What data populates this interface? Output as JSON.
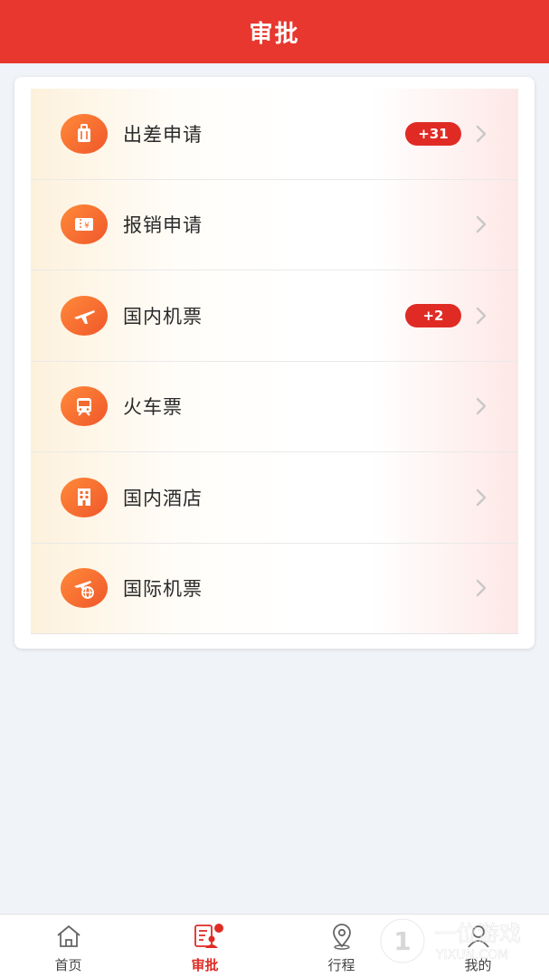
{
  "header": {
    "title": "审批"
  },
  "menu": {
    "items": [
      {
        "label": "出差申请",
        "icon": "luggage-icon",
        "badge": "+31"
      },
      {
        "label": "报销申请",
        "icon": "reimbursement-ticket-icon",
        "badge": ""
      },
      {
        "label": "国内机票",
        "icon": "airplane-icon",
        "badge": "+2"
      },
      {
        "label": "火车票",
        "icon": "train-icon",
        "badge": ""
      },
      {
        "label": "国内酒店",
        "icon": "hotel-icon",
        "badge": ""
      },
      {
        "label": "国际机票",
        "icon": "international-flight-icon",
        "badge": ""
      }
    ]
  },
  "tabbar": {
    "tabs": [
      {
        "label": "首页",
        "icon": "home-icon",
        "active": false
      },
      {
        "label": "审批",
        "icon": "approval-icon",
        "active": true
      },
      {
        "label": "行程",
        "icon": "location-pin-icon",
        "active": false
      },
      {
        "label": "我的",
        "icon": "user-icon",
        "active": false
      }
    ]
  },
  "watermark": {
    "text": "一位游戏",
    "subtext": "YIXUN.COM"
  },
  "colors": {
    "primary": "#e8372e",
    "badge": "#e02b25",
    "icon_gradient_start": "#ff8a3a",
    "icon_gradient_end": "#f0572a",
    "background": "#f0f3f7"
  }
}
